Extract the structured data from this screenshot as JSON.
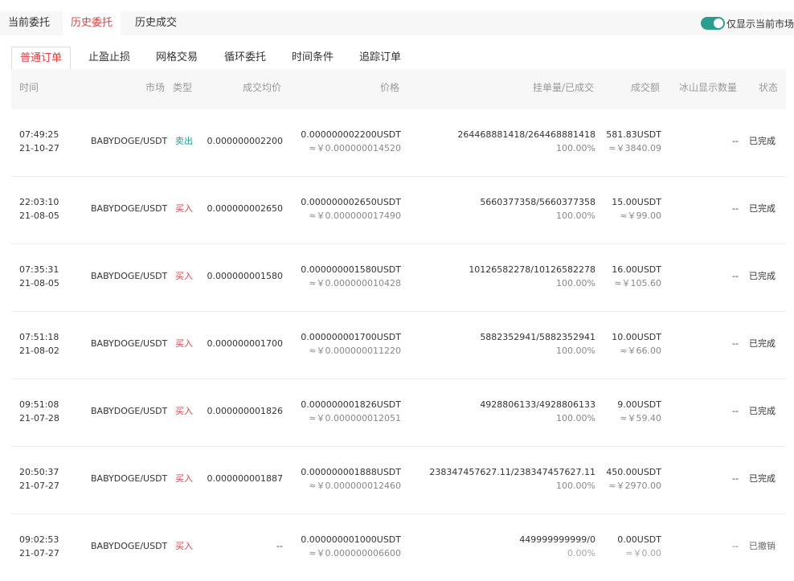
{
  "top_tabs": [
    "当前委托",
    "历史委托",
    "历史成交"
  ],
  "toggle_label": "仅显示当前市场",
  "sub_tabs": [
    "普通订单",
    "止盈止损",
    "网格交易",
    "循环委托",
    "时间条件",
    "追踪订单"
  ],
  "columns": {
    "time": "时间",
    "market": "市场",
    "type": "类型",
    "avg_price": "成交均价",
    "price": "价格",
    "qty": "挂单量/已成交",
    "amount": "成交额",
    "iceberg": "冰山显示数量",
    "status": "状态"
  },
  "rows": [
    {
      "time": "07:49:25",
      "date": "21-10-27",
      "market": "BABYDOGE/USDT",
      "type": "卖出",
      "side": "sell",
      "avg": "0.000000002200",
      "price": "0.000000002200USDT",
      "price_cny": "≈￥0.000000014520",
      "qty": "264468881418/264468881418",
      "pct": "100.00%",
      "amount": "581.83USDT",
      "amount_cny": "≈￥3840.09",
      "iceberg": "--",
      "status": "已完成"
    },
    {
      "time": "22:03:10",
      "date": "21-08-05",
      "market": "BABYDOGE/USDT",
      "type": "买入",
      "side": "buy",
      "avg": "0.000000002650",
      "price": "0.000000002650USDT",
      "price_cny": "≈￥0.000000017490",
      "qty": "5660377358/5660377358",
      "pct": "100.00%",
      "amount": "15.00USDT",
      "amount_cny": "≈￥99.00",
      "iceberg": "--",
      "status": "已完成"
    },
    {
      "time": "07:35:31",
      "date": "21-08-05",
      "market": "BABYDOGE/USDT",
      "type": "买入",
      "side": "buy",
      "avg": "0.000000001580",
      "price": "0.000000001580USDT",
      "price_cny": "≈￥0.000000010428",
      "qty": "10126582278/10126582278",
      "pct": "100.00%",
      "amount": "16.00USDT",
      "amount_cny": "≈￥105.60",
      "iceberg": "--",
      "status": "已完成"
    },
    {
      "time": "07:51:18",
      "date": "21-08-02",
      "market": "BABYDOGE/USDT",
      "type": "买入",
      "side": "buy",
      "avg": "0.000000001700",
      "price": "0.000000001700USDT",
      "price_cny": "≈￥0.000000011220",
      "qty": "5882352941/5882352941",
      "pct": "100.00%",
      "amount": "10.00USDT",
      "amount_cny": "≈￥66.00",
      "iceberg": "--",
      "status": "已完成"
    },
    {
      "time": "09:51:08",
      "date": "21-07-28",
      "market": "BABYDOGE/USDT",
      "type": "买入",
      "side": "buy",
      "avg": "0.000000001826",
      "price": "0.000000001826USDT",
      "price_cny": "≈￥0.000000012051",
      "qty": "4928806133/4928806133",
      "pct": "100.00%",
      "amount": "9.00USDT",
      "amount_cny": "≈￥59.40",
      "iceberg": "--",
      "status": "已完成"
    },
    {
      "time": "20:50:37",
      "date": "21-07-27",
      "market": "BABYDOGE/USDT",
      "type": "买入",
      "side": "buy",
      "avg": "0.000000001887",
      "price": "0.000000001888USDT",
      "price_cny": "≈￥0.000000012460",
      "qty": "238347457627.11/238347457627.11",
      "pct": "100.00%",
      "amount": "450.00USDT",
      "amount_cny": "≈￥2970.00",
      "iceberg": "--",
      "status": "已完成"
    },
    {
      "time": "09:02:53",
      "date": "21-07-27",
      "market": "BABYDOGE/USDT",
      "type": "买入",
      "side": "buy",
      "avg": "--",
      "price": "0.000000001000USDT",
      "price_cny": "≈￥0.000000006600",
      "qty": "449999999999/0",
      "pct": "0.00%",
      "amount": "0.00USDT",
      "amount_cny": "≈￥0.00",
      "iceberg": "--",
      "status": "已撤销"
    }
  ]
}
